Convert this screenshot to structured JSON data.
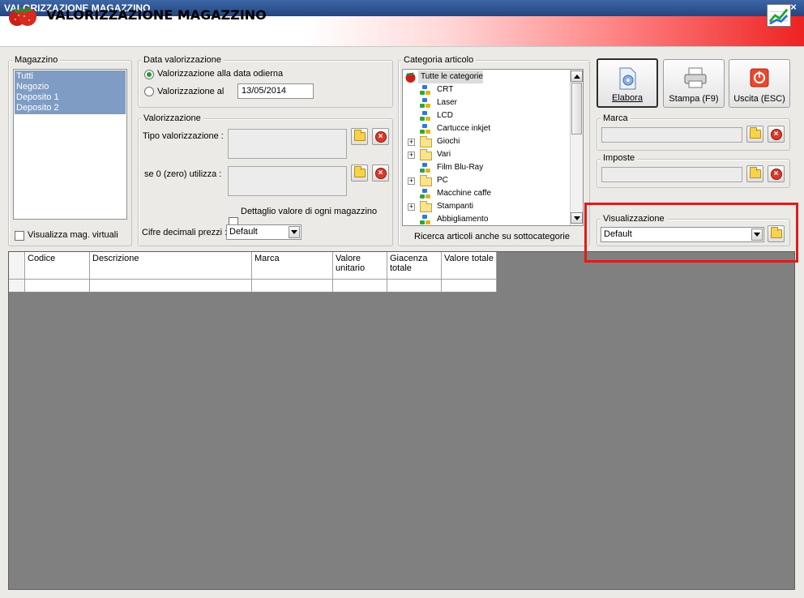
{
  "window": {
    "title": "VALORIZZAZIONE MAGAZZINO",
    "close_glyph": "×"
  },
  "header": {
    "title": "VALORIZZAZIONE MAGAZZINO",
    "logo_icon": "strawberry-icon",
    "right_icon": "chart-icon"
  },
  "magazzino": {
    "label": "Magazzino",
    "items": [
      "Tutti",
      "Negozio",
      "Deposito 1",
      "Deposito 2"
    ],
    "virtual_label": "Visualizza mag. virtuali",
    "virtual_checked": false
  },
  "data_valorizzazione": {
    "label": "Data valorizzazione",
    "option_today": "Valorizzazione alla data odierna",
    "option_date": "Valorizzazione al",
    "date_value": "13/05/2014",
    "selected": "today"
  },
  "valorizzazione": {
    "label": "Valorizzazione",
    "tipo_label": "Tipo valorizzazione :",
    "zero_label": "se 0 (zero) utilizza :",
    "dettaglio_label": "Dettaglio valore di ogni magazzino",
    "dettaglio_checked": false,
    "cifre_label": "Cifre decimali prezzi :",
    "cifre_value": "Default"
  },
  "categoria": {
    "label": "Categoria articolo",
    "root": "Tutte le categorie",
    "items": [
      {
        "label": "CRT",
        "type": "leaf"
      },
      {
        "label": "Laser",
        "type": "leaf"
      },
      {
        "label": "LCD",
        "type": "leaf"
      },
      {
        "label": "Cartucce inkjet",
        "type": "leaf"
      },
      {
        "label": "Giochi",
        "type": "folder"
      },
      {
        "label": "Vari",
        "type": "folder"
      },
      {
        "label": "Film Blu-Ray",
        "type": "leaf"
      },
      {
        "label": "PC",
        "type": "folder"
      },
      {
        "label": "Macchine caffe",
        "type": "leaf"
      },
      {
        "label": "Stampanti",
        "type": "folder"
      },
      {
        "label": "Abbigliamento",
        "type": "leaf"
      }
    ],
    "subcat_label": "Ricerca articoli anche su sottocategorie",
    "subcat_checked": true
  },
  "toolbar": {
    "elabora": "Elabora",
    "stampa": "Stampa (F9)",
    "uscita": "Uscita (ESC)"
  },
  "marca": {
    "label": "Marca"
  },
  "imposte": {
    "label": "Imposte"
  },
  "visualizzazione": {
    "label": "Visualizzazione",
    "value": "Default"
  },
  "grid": {
    "columns": [
      "Codice",
      "Descrizione",
      "Marca",
      "Valore unitario",
      "Giacenza totale",
      "Valore totale"
    ]
  },
  "colors": {
    "selection": "#7f9cc4",
    "highlight": "#e01b1b",
    "grid_bg": "#808080"
  }
}
